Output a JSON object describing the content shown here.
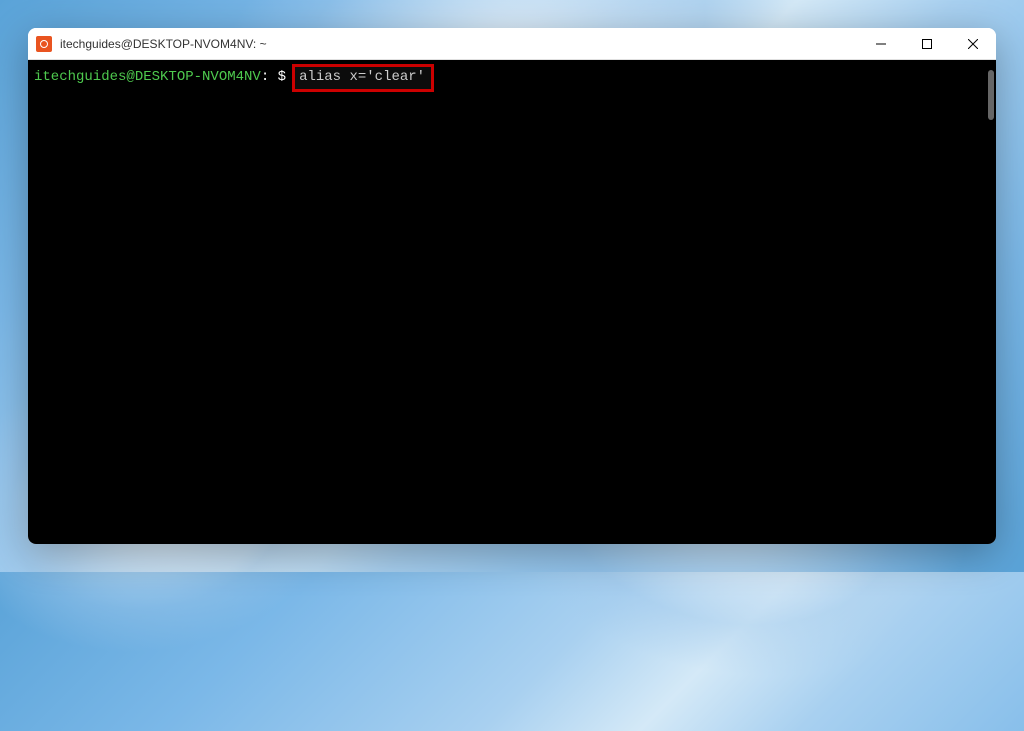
{
  "window": {
    "title": "itechguides@DESKTOP-NVOM4NV: ~"
  },
  "terminal": {
    "prompt": {
      "user_host": "itechguides@DESKTOP-NVOM4NV",
      "separator": ":",
      "path": "~",
      "symbol": "$"
    },
    "command": "alias x='clear'"
  }
}
